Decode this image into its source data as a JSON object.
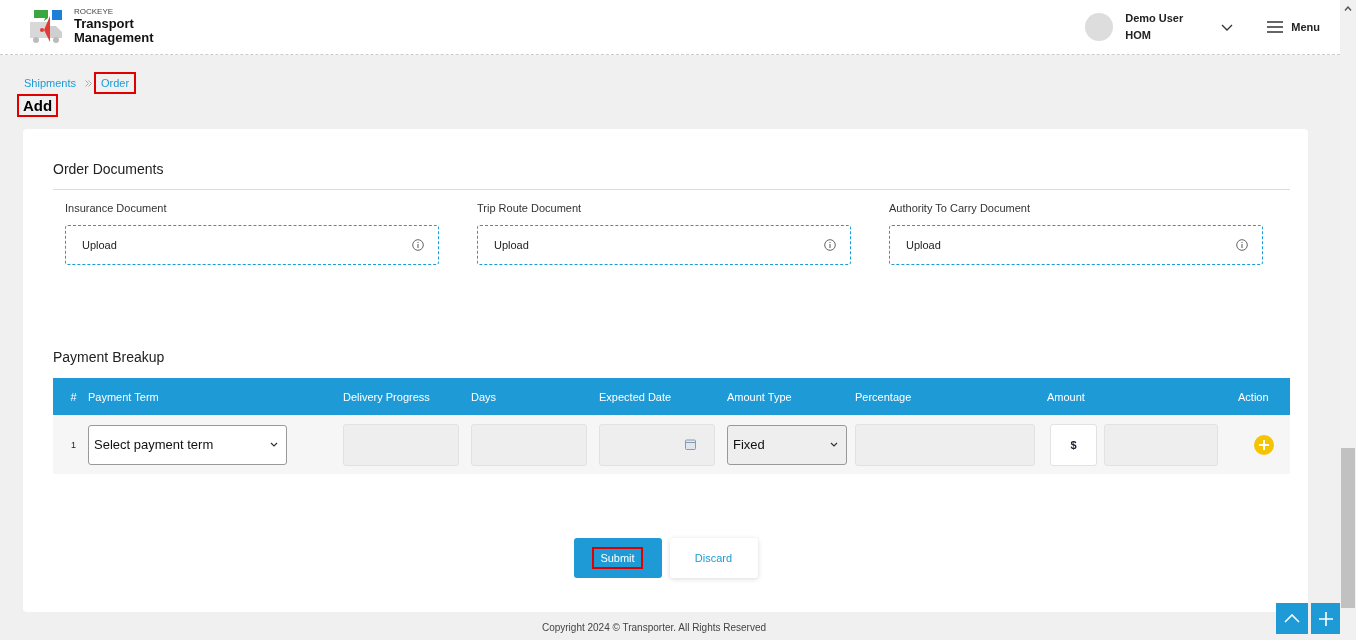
{
  "header": {
    "logo": {
      "brand": "ROCKEYE",
      "title_line_1": "Transport",
      "title_line_2": "Management"
    },
    "user": {
      "name": "Demo User",
      "role": "HOM"
    },
    "menu_label": "Menu"
  },
  "breadcrumb": [
    {
      "label": "Shipments",
      "highlighted": false
    },
    {
      "label": "Order",
      "highlighted": true
    }
  ],
  "page_title": {
    "text": "Add",
    "highlighted": true
  },
  "order_documents": {
    "title": "Order Documents",
    "fields": [
      {
        "label": "Insurance Document",
        "button": "Upload"
      },
      {
        "label": "Trip Route Document",
        "button": "Upload"
      },
      {
        "label": "Authority To Carry Document",
        "button": "Upload"
      }
    ]
  },
  "payment_breakup": {
    "title": "Payment Breakup",
    "columns": [
      "#",
      "Payment Term",
      "Delivery Progress",
      "Days",
      "Expected Date",
      "Amount Type",
      "Percentage",
      "Amount",
      "Action"
    ],
    "rows": [
      {
        "number": "1",
        "payment_term": "Select payment term",
        "amount_type": "Fixed",
        "currency": "$"
      }
    ]
  },
  "buttons": [
    {
      "label": "Submit",
      "kind": "primary",
      "highlighted": true
    },
    {
      "label": "Discard",
      "kind": "secondary",
      "highlighted": false
    }
  ],
  "footer": "Copyright 2024 © Transporter. All Rights Reserved"
}
